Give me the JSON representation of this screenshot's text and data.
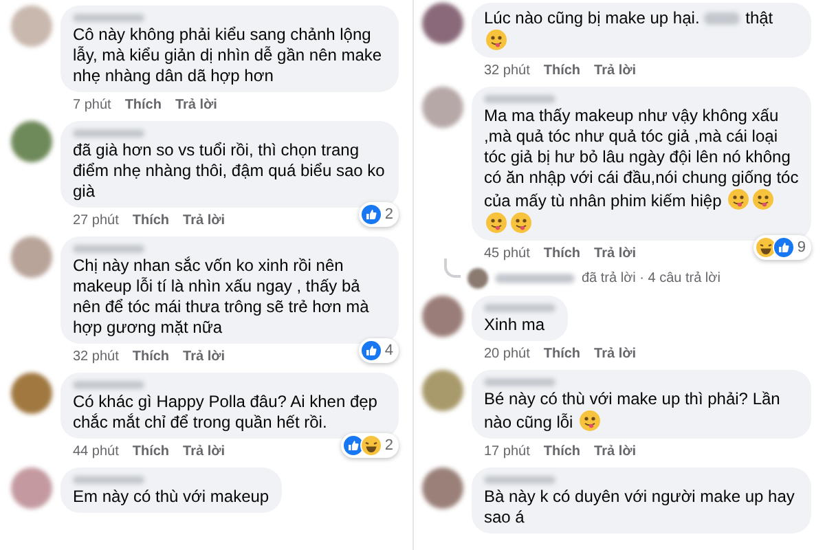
{
  "columns": [
    {
      "comments": [
        {
          "kind": "full",
          "parts": [
            {
              "kind": "text",
              "text": "Cô này không phải kiểu sang chảnh lộng lẫy, mà kiểu giản dị nhìn dễ gần nên make nhẹ nhàng dân dã hợp hơn"
            }
          ],
          "time": "7 phút",
          "like": "Thích",
          "reply": "Trả lời"
        },
        {
          "kind": "full",
          "parts": [
            {
              "kind": "text",
              "text": "đã già hơn so vs tuổi rồi, thì chọn trang điểm nhẹ nhàng thôi, đậm quá biểu sao ko già"
            }
          ],
          "time": "27 phút",
          "like": "Thích",
          "reply": "Trả lời",
          "reactions": {
            "icons": [
              {
                "kind": "like"
              }
            ],
            "count": "2"
          }
        },
        {
          "kind": "full",
          "parts": [
            {
              "kind": "text",
              "text": "Chị này nhan sắc vốn ko xinh rồi nên makeup lỗi tí là nhìn xấu ngay , thấy bả nên để tóc mái thưa trông sẽ trẻ hơn mà hợp gương mặt nữa"
            }
          ],
          "time": "32 phút",
          "like": "Thích",
          "reply": "Trả lời",
          "reactions": {
            "icons": [
              {
                "kind": "like"
              }
            ],
            "count": "4"
          }
        },
        {
          "kind": "full",
          "parts": [
            {
              "kind": "text",
              "text": "Có khác gì Happy Polla đâu? Ai khen đẹp chắc mắt chỉ để trong quần hết rồi."
            }
          ],
          "time": "44 phút",
          "like": "Thích",
          "reply": "Trả lời",
          "reactions": {
            "icons": [
              {
                "kind": "like"
              },
              {
                "kind": "haha"
              }
            ],
            "count": "2"
          }
        },
        {
          "kind": "full",
          "parts": [
            {
              "kind": "text",
              "text": "Em này có thù với makeup"
            }
          ]
        }
      ]
    },
    {
      "comments": [
        {
          "kind": "partial",
          "parts": [
            {
              "kind": "text",
              "text": "Lúc nào cũng bị make up hại."
            },
            {
              "kind": "blur"
            },
            {
              "kind": "text",
              "text": "thật"
            },
            {
              "kind": "emoji"
            }
          ],
          "time": "32 phút",
          "like": "Thích",
          "reply": "Trả lời"
        },
        {
          "kind": "full",
          "parts": [
            {
              "kind": "text",
              "text": "Ma ma thấy makeup như vậy không xấu ,mà quả tóc như quả tóc giả ,mà cái loại tóc giả bị hư bỏ lâu ngày đội lên nó không có ăn nhập với  cái đầu,nói chung giống tóc của mấy tù nhân phim kiếm hiệp"
            },
            {
              "kind": "emoji"
            },
            {
              "kind": "emoji"
            },
            {
              "kind": "emoji"
            },
            {
              "kind": "emoji"
            }
          ],
          "time": "45 phút",
          "like": "Thích",
          "reply": "Trả lời",
          "reactions": {
            "icons": [
              {
                "kind": "haha"
              },
              {
                "kind": "like"
              }
            ],
            "count": "9"
          },
          "replies": "đã trả lời · 4 câu trả lời"
        },
        {
          "kind": "full",
          "parts": [
            {
              "kind": "text",
              "text": "Xinh ma"
            }
          ],
          "time": "20 phút",
          "like": "Thích",
          "reply": "Trả lời"
        },
        {
          "kind": "full",
          "parts": [
            {
              "kind": "text",
              "text": "Bé này có thù với make up thì phải? Lần nào cũng lỗi"
            },
            {
              "kind": "emoji"
            }
          ],
          "time": "17 phút",
          "like": "Thích",
          "reply": "Trả lời"
        },
        {
          "kind": "full",
          "parts": [
            {
              "kind": "text",
              "text": "Bà này k có duyên với người make up hay sao á"
            }
          ]
        }
      ]
    }
  ]
}
